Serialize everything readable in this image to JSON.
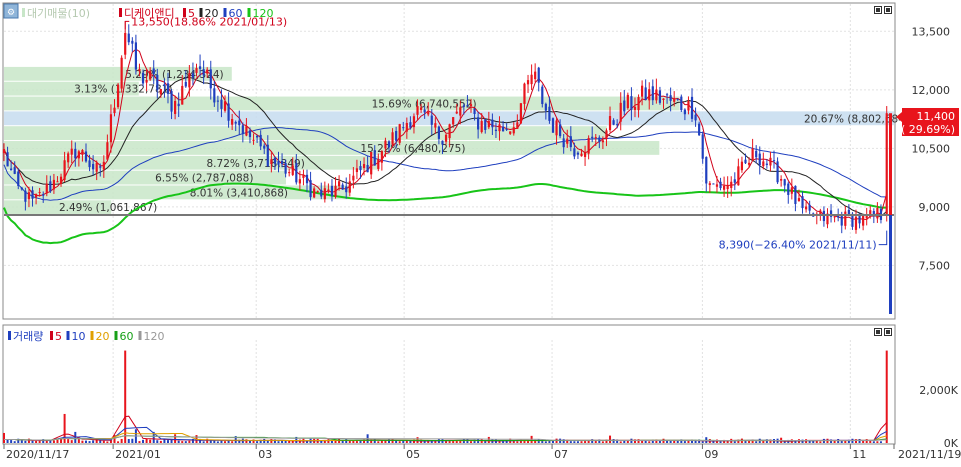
{
  "price_panel": {
    "legend": [
      {
        "text": "대기매물(10)",
        "color": "#b5c9b0"
      },
      {
        "text": "디케이앤디",
        "color": "#d0021b"
      },
      {
        "text": "5",
        "color": "#d0021b"
      },
      {
        "text": "20",
        "color": "#222222"
      },
      {
        "text": "60",
        "color": "#1f3fbf"
      },
      {
        "text": "120",
        "color": "#18c418"
      }
    ],
    "icon": "chart-setting-icon",
    "price_tag": {
      "price": "11,400",
      "change": "( 29.69%)",
      "color": "#e8141c"
    },
    "annotations": {
      "high": "13,550(18.86% 2021/01/13)",
      "low": "8,390(−26.40% 2021/11/11)"
    }
  },
  "volume_panel": {
    "legend": [
      {
        "text": "거래량",
        "color": "#1f3fbf"
      },
      {
        "text": "5",
        "color": "#d0021b"
      },
      {
        "text": "10",
        "color": "#1f3fbf"
      },
      {
        "text": "20",
        "color": "#e0a000"
      },
      {
        "text": "60",
        "color": "#18a018"
      },
      {
        "text": "120",
        "color": "#999999"
      }
    ]
  },
  "colors": {
    "up": "#e8141c",
    "down": "#1f3fbf",
    "ma5": "#d0021b",
    "ma20": "#222222",
    "ma60": "#1f3fbf",
    "ma120": "#18c418",
    "overhang": "#c8e6c8",
    "overhang_hi": "#c6dcef"
  },
  "chart_data": [
    {
      "type": "candlestick",
      "title": "디케이앤디",
      "y_ticks": [
        "13,500",
        "12,000",
        "10,500",
        "9,000",
        "7,500"
      ],
      "y_tick_values": [
        13500,
        12000,
        10500,
        9000,
        7500
      ],
      "ylim": [
        6150,
        14200
      ],
      "x_ticks": [
        "2020/11/17",
        "2021/01",
        "03",
        "05",
        "07",
        "09",
        "11",
        "2021/11/19"
      ],
      "x_tick_days": [
        0,
        45,
        104,
        165,
        226,
        288,
        349,
        367
      ],
      "reference_price": 8790,
      "last_price": 11400,
      "last_change_pct": 29.69,
      "high": {
        "price": 13550,
        "pct": 18.86,
        "date": "2021/01/13"
      },
      "low": {
        "price": 8390,
        "pct": -26.4,
        "date": "2021/11/11"
      },
      "anchors": [
        [
          0,
          10400
        ],
        [
          5,
          9500
        ],
        [
          12,
          9100
        ],
        [
          20,
          9600
        ],
        [
          30,
          10500
        ],
        [
          40,
          9800
        ],
        [
          45,
          11500
        ],
        [
          50,
          13550
        ],
        [
          55,
          12400
        ],
        [
          62,
          12200
        ],
        [
          70,
          11600
        ],
        [
          80,
          12700
        ],
        [
          85,
          12100
        ],
        [
          90,
          11700
        ],
        [
          100,
          10900
        ],
        [
          110,
          10200
        ],
        [
          120,
          9800
        ],
        [
          130,
          9300
        ],
        [
          140,
          9450
        ],
        [
          150,
          10100
        ],
        [
          160,
          10700
        ],
        [
          170,
          11500
        ],
        [
          180,
          10800
        ],
        [
          190,
          11600
        ],
        [
          195,
          11200
        ],
        [
          205,
          11000
        ],
        [
          210,
          11100
        ],
        [
          218,
          12450
        ],
        [
          225,
          11200
        ],
        [
          235,
          10500
        ],
        [
          245,
          10700
        ],
        [
          255,
          11500
        ],
        [
          265,
          11900
        ],
        [
          275,
          11700
        ],
        [
          285,
          11500
        ],
        [
          290,
          9500
        ],
        [
          300,
          9600
        ],
        [
          310,
          10400
        ],
        [
          320,
          9800
        ],
        [
          330,
          8800
        ],
        [
          340,
          8700
        ],
        [
          349,
          8700
        ],
        [
          355,
          8650
        ],
        [
          360,
          8800
        ],
        [
          363,
          8790
        ],
        [
          364,
          11400
        ]
      ],
      "overhang_rows": [
        {
          "label": "5.29% (1,234,324)",
          "pct": 5.29
        },
        {
          "label": "3.13% (1,332,781)",
          "pct": 3.13
        },
        {
          "label": "15.69% (6,740,552)",
          "pct": 15.69
        },
        {
          "label": "20.67% (8,802,684)",
          "pct": 20.67
        },
        {
          "label": "",
          "pct": 14.0
        },
        {
          "label": "15.22% (6,480,275)",
          "pct": 15.22
        },
        {
          "label": "8.72% (3,718,349)",
          "pct": 8.72
        },
        {
          "label": "6.55% (2,787,088)",
          "pct": 6.55
        },
        {
          "label": "8.01% (3,410,868)",
          "pct": 8.01
        },
        {
          "label": "2.49% (1,061,867)",
          "pct": 2.49
        }
      ],
      "overhang_range": [
        8800,
        12600
      ]
    },
    {
      "type": "bar",
      "title": "거래량",
      "y_ticks": [
        "2,000K",
        "0K"
      ],
      "y_tick_values": [
        2000,
        0
      ],
      "ylim": [
        0,
        3900
      ],
      "volume_spikes": [
        [
          0,
          380
        ],
        [
          25,
          1100
        ],
        [
          30,
          420
        ],
        [
          45,
          300
        ],
        [
          50,
          3500
        ],
        [
          55,
          520
        ],
        [
          62,
          420
        ],
        [
          70,
          330
        ],
        [
          80,
          300
        ],
        [
          95,
          260
        ],
        [
          120,
          230
        ],
        [
          150,
          330
        ],
        [
          170,
          220
        ],
        [
          200,
          230
        ],
        [
          218,
          270
        ],
        [
          250,
          280
        ],
        [
          290,
          220
        ],
        [
          320,
          200
        ],
        [
          364,
          3500
        ]
      ]
    }
  ]
}
